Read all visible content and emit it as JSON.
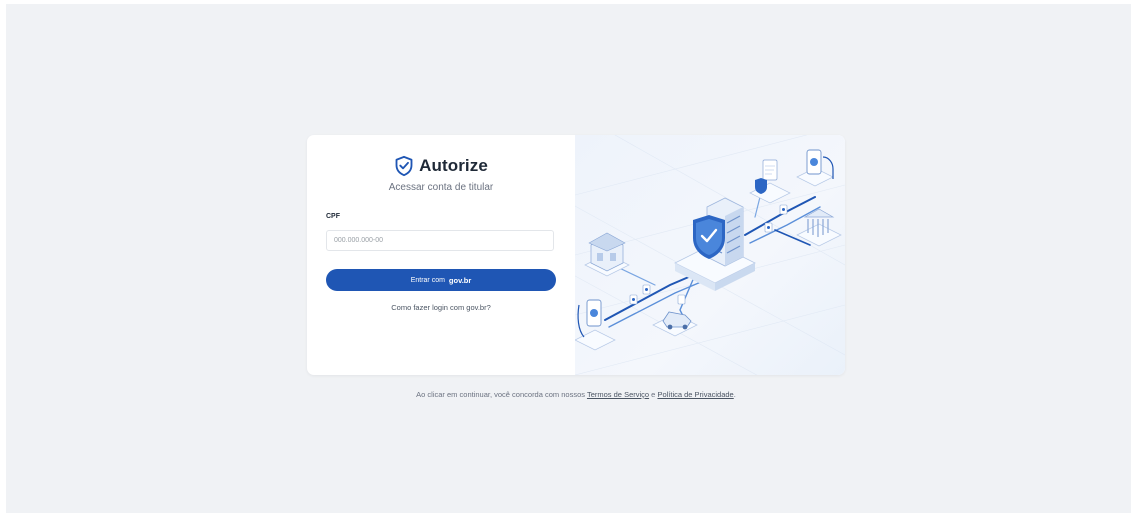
{
  "brand": {
    "name": "Autorize",
    "logo_icon": "shield-check-icon"
  },
  "login": {
    "subtitle": "Acessar conta de titular",
    "cpf_label": "CPF",
    "cpf_placeholder": "000.000.000-00",
    "button_prefix": "Entrar com",
    "button_brand": "gov.br",
    "help_link": "Como fazer login com gov.br?"
  },
  "illustration": {
    "icon": "secure-data-network-illustration"
  },
  "footer": {
    "text_before": "Ao clicar em continuar, você concorda com nossos",
    "terms": "Termos de Serviço",
    "conjunction": "e",
    "privacy": "Política de Privacidade",
    "text_after": "."
  },
  "colors": {
    "primary": "#1f56b4",
    "background": "#f0f2f5",
    "card": "#ffffff"
  }
}
